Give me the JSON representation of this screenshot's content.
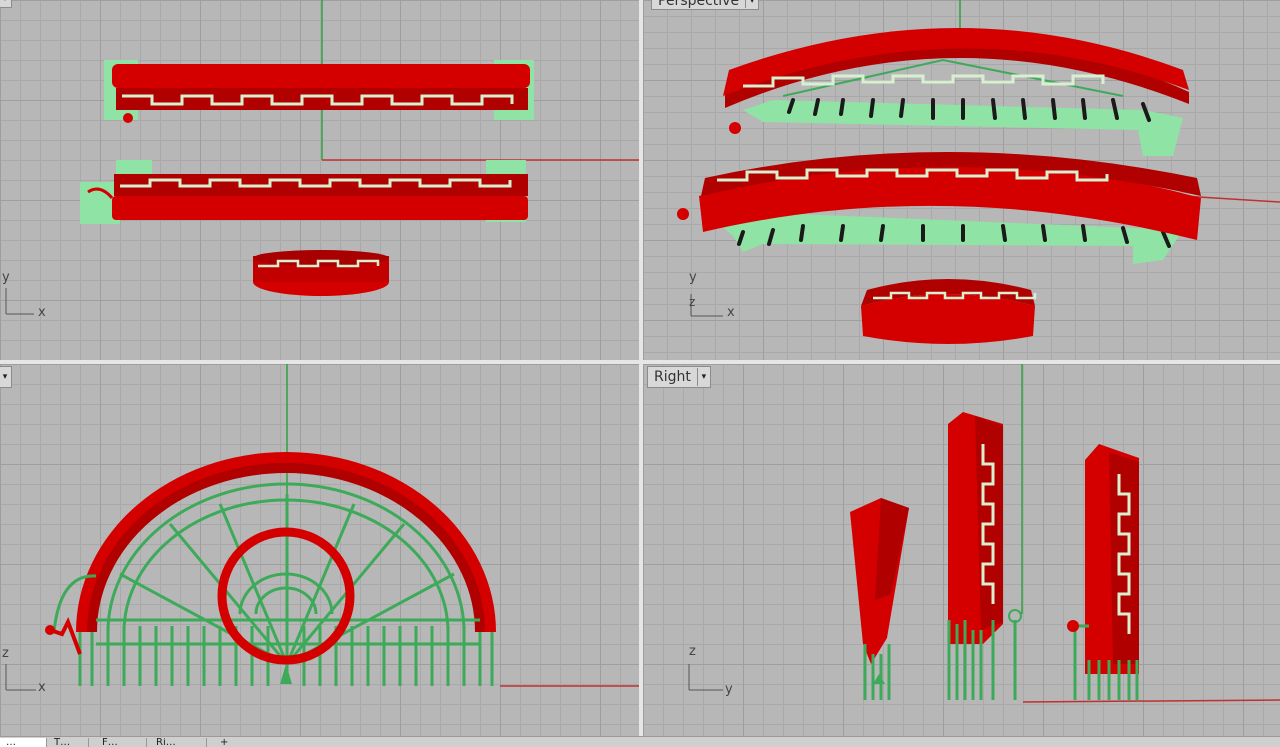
{
  "viewports": {
    "top": {
      "label": ""
    },
    "perspective": {
      "label": "Perspective"
    },
    "front": {
      "label": ""
    },
    "right": {
      "label": "Right"
    }
  },
  "axes": {
    "top": {
      "a": "y",
      "b": "x"
    },
    "perspective": {
      "a": "y",
      "b": "x",
      "c": "z"
    },
    "front": {
      "a": "z",
      "b": "x"
    },
    "right": {
      "a": "z",
      "b": "y"
    }
  },
  "tabs": [
    "…",
    "T…",
    "F…",
    "Ri…",
    "+"
  ],
  "colors": {
    "object": "#d40000",
    "support": "#3daa5a",
    "support_base": "#8fe3a4",
    "x_axis": "#c03030",
    "y_axis": "#30a040",
    "grid": "#b7b7b7"
  }
}
